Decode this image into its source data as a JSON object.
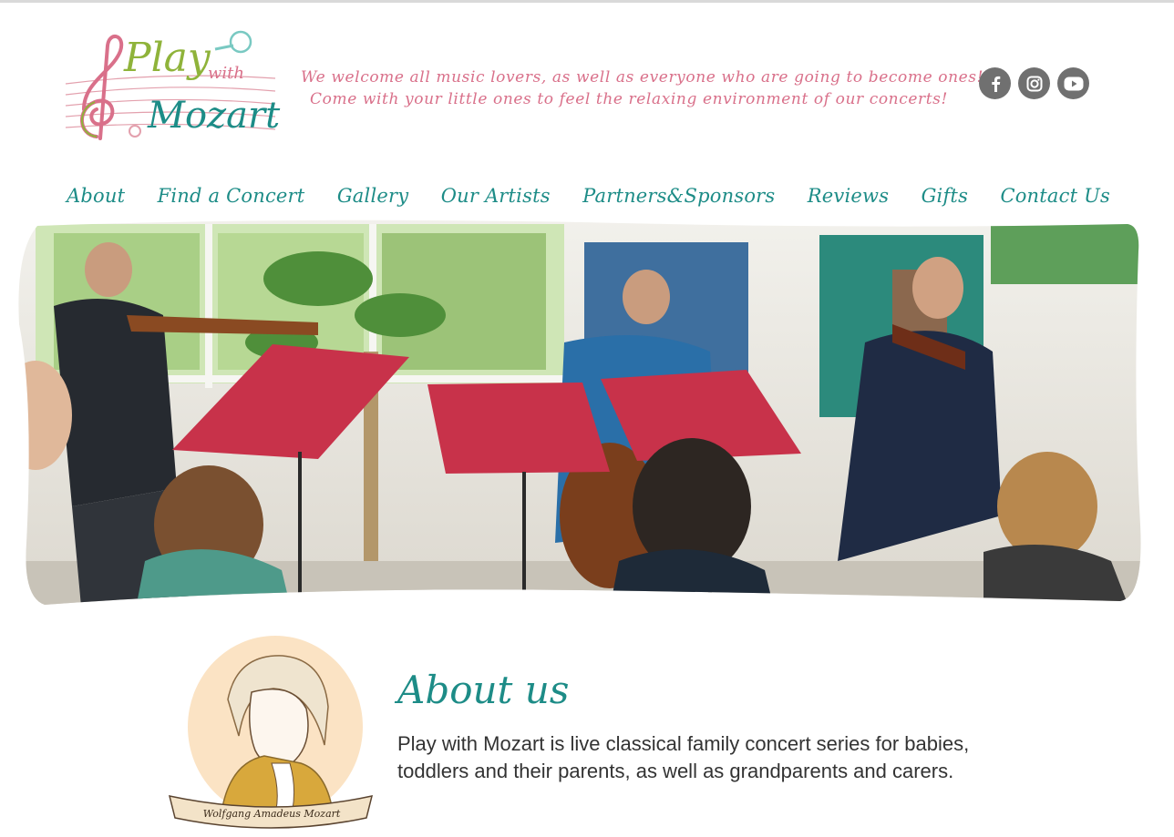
{
  "logo": {
    "word_play": "Play",
    "word_with": "with",
    "word_mozart": "Mozart"
  },
  "tagline": {
    "line1": "We welcome all music lovers, as well as everyone who are going to become ones!",
    "line2": "Come with your little ones to feel the relaxing environment of our concerts!"
  },
  "social": [
    {
      "icon": "facebook-icon"
    },
    {
      "icon": "instagram-icon"
    },
    {
      "icon": "youtube-icon"
    }
  ],
  "nav": [
    {
      "label": "About"
    },
    {
      "label": "Find a Concert"
    },
    {
      "label": "Gallery"
    },
    {
      "label": "Our Artists"
    },
    {
      "label": "Partners&Sponsors"
    },
    {
      "label": "Reviews"
    },
    {
      "label": "Gifts"
    },
    {
      "label": "Contact Us"
    }
  ],
  "hero": {
    "image": "string-quartet-concert-photo"
  },
  "about": {
    "title": "About us",
    "portrait_caption": "Wolfgang Amadeus Mozart",
    "text": "Play with Mozart is live classical family concert series for babies, toddlers and their parents, as well as grandparents and carers."
  },
  "colors": {
    "brand_teal": "#1d8c87",
    "tagline_pink": "#d9708a",
    "logo_green": "#8fb33a",
    "icon_gray": "#707070",
    "music_stand_red": "#c8324a"
  }
}
